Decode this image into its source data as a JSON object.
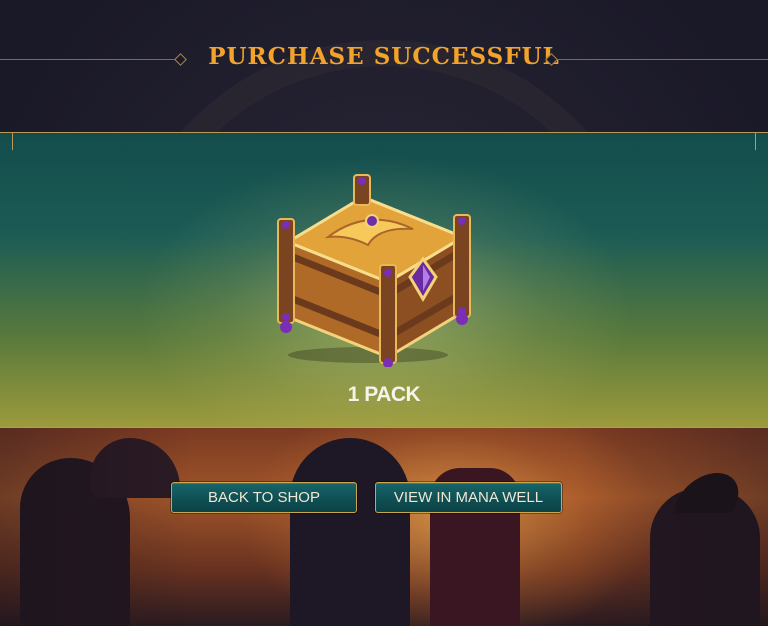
{
  "header": {
    "title": "PURCHASE SUCCESSFUL"
  },
  "reward": {
    "label": "1 PACK",
    "icon": "treasure-chest-pack-icon"
  },
  "actions": {
    "back_to_shop": "BACK TO SHOP",
    "view_in_mana_well": "VIEW IN MANA WELL"
  },
  "colors": {
    "title": "#f2a32c",
    "banner_top": "#134c4c",
    "banner_bottom": "#9c9a3c",
    "button_fill": "#0f5054",
    "button_border": "#c9a64f",
    "frame_gold": "#b89a56"
  }
}
